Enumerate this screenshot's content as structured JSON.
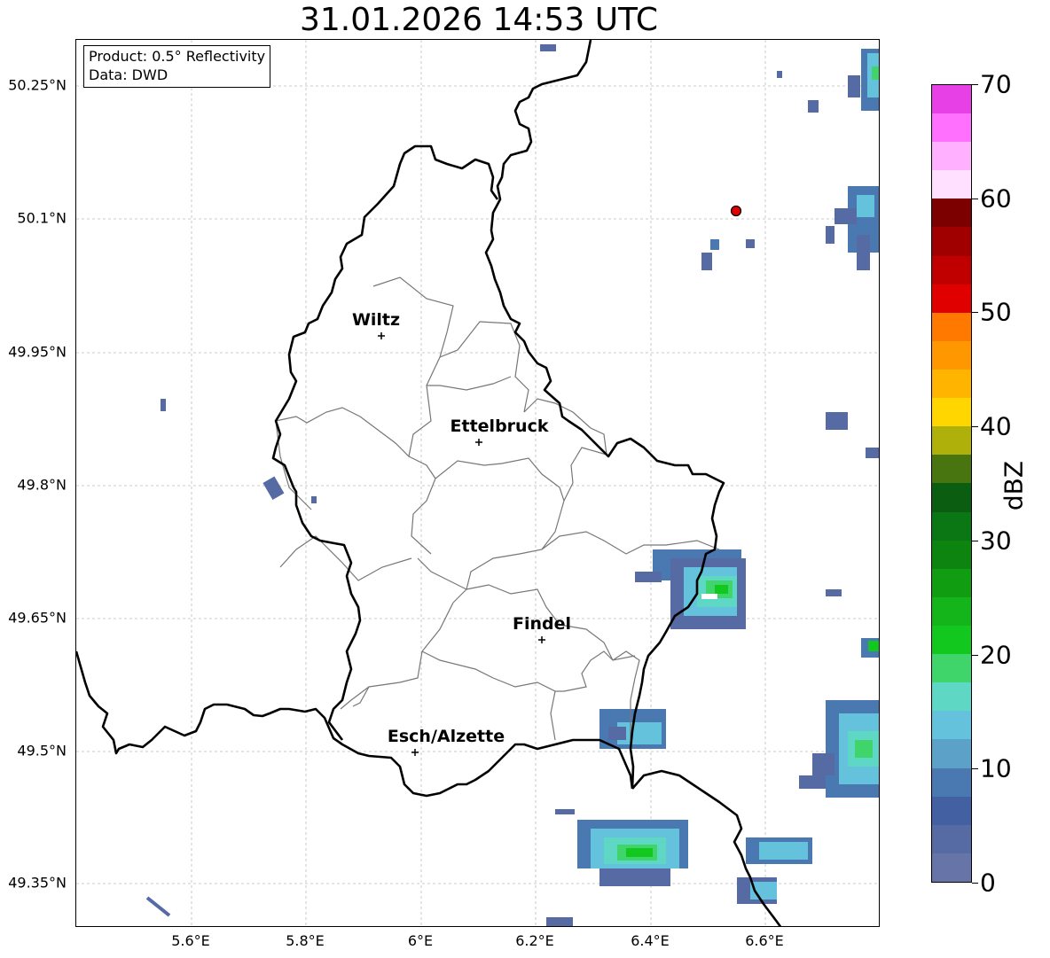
{
  "title": "31.01.2026 14:53 UTC",
  "info": {
    "product": "Product: 0.5° Reflectivity",
    "source": "Data: DWD"
  },
  "axes": {
    "lat_labels": [
      "50.25°N",
      "50.1°N",
      "49.95°N",
      "49.8°N",
      "49.65°N",
      "49.5°N",
      "49.35°N"
    ],
    "lon_labels": [
      "5.6°E",
      "5.8°E",
      "6°E",
      "6.2°E",
      "6.4°E",
      "6.6°E"
    ]
  },
  "cities": [
    {
      "name": "Wiltz"
    },
    {
      "name": "Ettelbruck"
    },
    {
      "name": "Findel"
    },
    {
      "name": "Esch/Alzette"
    }
  ],
  "colorbar": {
    "unit": "dBZ",
    "tick_labels": [
      "0",
      "10",
      "20",
      "30",
      "40",
      "50",
      "60",
      "70"
    ],
    "colors": [
      "#6774a8",
      "#566aa4",
      "#4360a2",
      "#4a78b0",
      "#5ba1c8",
      "#65c2dc",
      "#5ed7c4",
      "#3fd56a",
      "#12c71e",
      "#14b51a",
      "#109d12",
      "#0e8410",
      "#0b7614",
      "#0b5d12",
      "#487510",
      "#b0b00a",
      "#ffd600",
      "#ffb500",
      "#ff9800",
      "#ff7800",
      "#e00000",
      "#c00000",
      "#a00000",
      "#7c0000",
      "#ffe0ff",
      "#ffb0ff",
      "#ff70ff",
      "#e640e6"
    ]
  },
  "chart_data": {
    "type": "map",
    "title": "31.01.2026 14:53 UTC",
    "product": "0.5° Reflectivity",
    "source": "DWD",
    "lat_range": [
      49.29,
      50.3
    ],
    "lon_range": [
      5.4,
      6.8
    ],
    "radar_site": {
      "lat": 50.11,
      "lon": 6.55
    },
    "cities": [
      {
        "name": "Wiltz",
        "lat": 49.97,
        "lon": 5.93
      },
      {
        "name": "Ettelbruck",
        "lat": 49.85,
        "lon": 6.1
      },
      {
        "name": "Findel",
        "lat": 49.63,
        "lon": 6.21
      },
      {
        "name": "Esch/Alzette",
        "lat": 49.5,
        "lon": 5.99
      }
    ],
    "colorbar_range_dbz": [
      0,
      70
    ],
    "colorbar_step_dbz": 2.5
  }
}
